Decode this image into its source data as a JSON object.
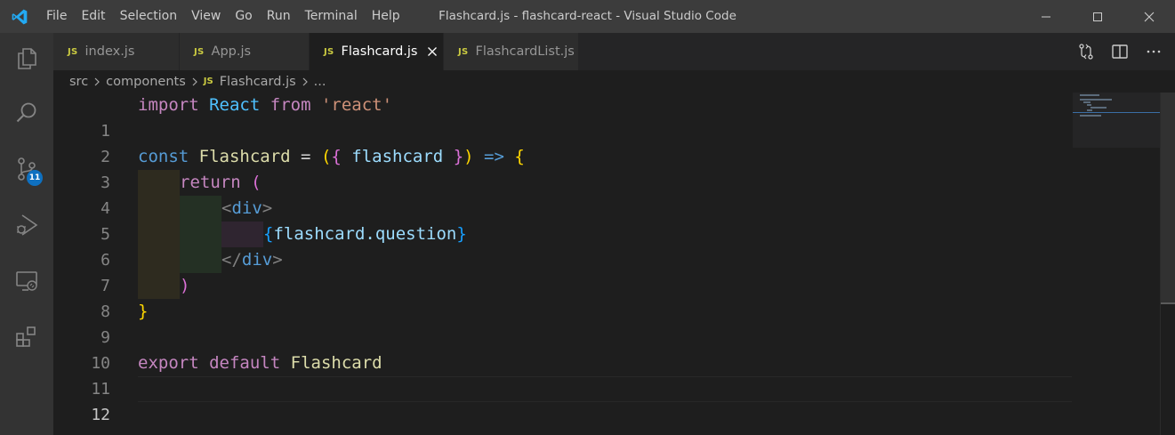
{
  "window": {
    "title": "Flashcard.js - flashcard-react - Visual Studio Code"
  },
  "menu": [
    "File",
    "Edit",
    "Selection",
    "View",
    "Go",
    "Run",
    "Terminal",
    "Help"
  ],
  "activity_bar": {
    "icons": [
      "explorer-icon",
      "search-icon",
      "source-control-icon",
      "run-debug-icon",
      "remote-explorer-icon",
      "extensions-icon"
    ],
    "source_control_badge": "11"
  },
  "tabs": [
    {
      "label": "index.js",
      "icon": "JS",
      "active": false
    },
    {
      "label": "App.js",
      "icon": "JS",
      "active": false
    },
    {
      "label": "Flashcard.js",
      "icon": "JS",
      "active": true
    },
    {
      "label": "FlashcardList.js",
      "icon": "JS",
      "active": false
    }
  ],
  "breadcrumb": {
    "parts": [
      "src",
      "components",
      "Flashcard.js",
      "..."
    ],
    "file_icon": "JS"
  },
  "editor": {
    "line_numbers": [
      "1",
      "2",
      "3",
      "4",
      "5",
      "6",
      "7",
      "8",
      "9",
      "10",
      "11",
      "12"
    ],
    "current_line": "12",
    "tokens": {
      "l1_import": "import",
      "l1_react": "React",
      "l1_from": "from",
      "l1_str": "'react'",
      "l3_const": "const",
      "l3_name": "Flashcard",
      "l3_eq": " = ",
      "l3_paren_open": "(",
      "l3_brace_open": "{",
      "l3_param": " flashcard ",
      "l3_brace_close": "}",
      "l3_paren_close": ")",
      "l3_arrow": " => ",
      "l3_body_open": "{",
      "l4_return": "return",
      "l4_paren": " (",
      "l5_lt": "<",
      "l5_tag": "div",
      "l5_gt": ">",
      "l6_open": "{",
      "l6_expr": "flashcard.question",
      "l6_close": "}",
      "l7_lt": "</",
      "l7_tag": "div",
      "l7_gt": ">",
      "l8_paren": ")",
      "l9_brace": "}",
      "l11_export": "export",
      "l11_default": "default",
      "l11_name": "Flashcard"
    }
  },
  "colors": {
    "titlebar": "#3c3c3c",
    "activitybar": "#333333",
    "editor_bg": "#1e1e1e",
    "badge": "#0e70c0",
    "accent": "#007acc"
  }
}
